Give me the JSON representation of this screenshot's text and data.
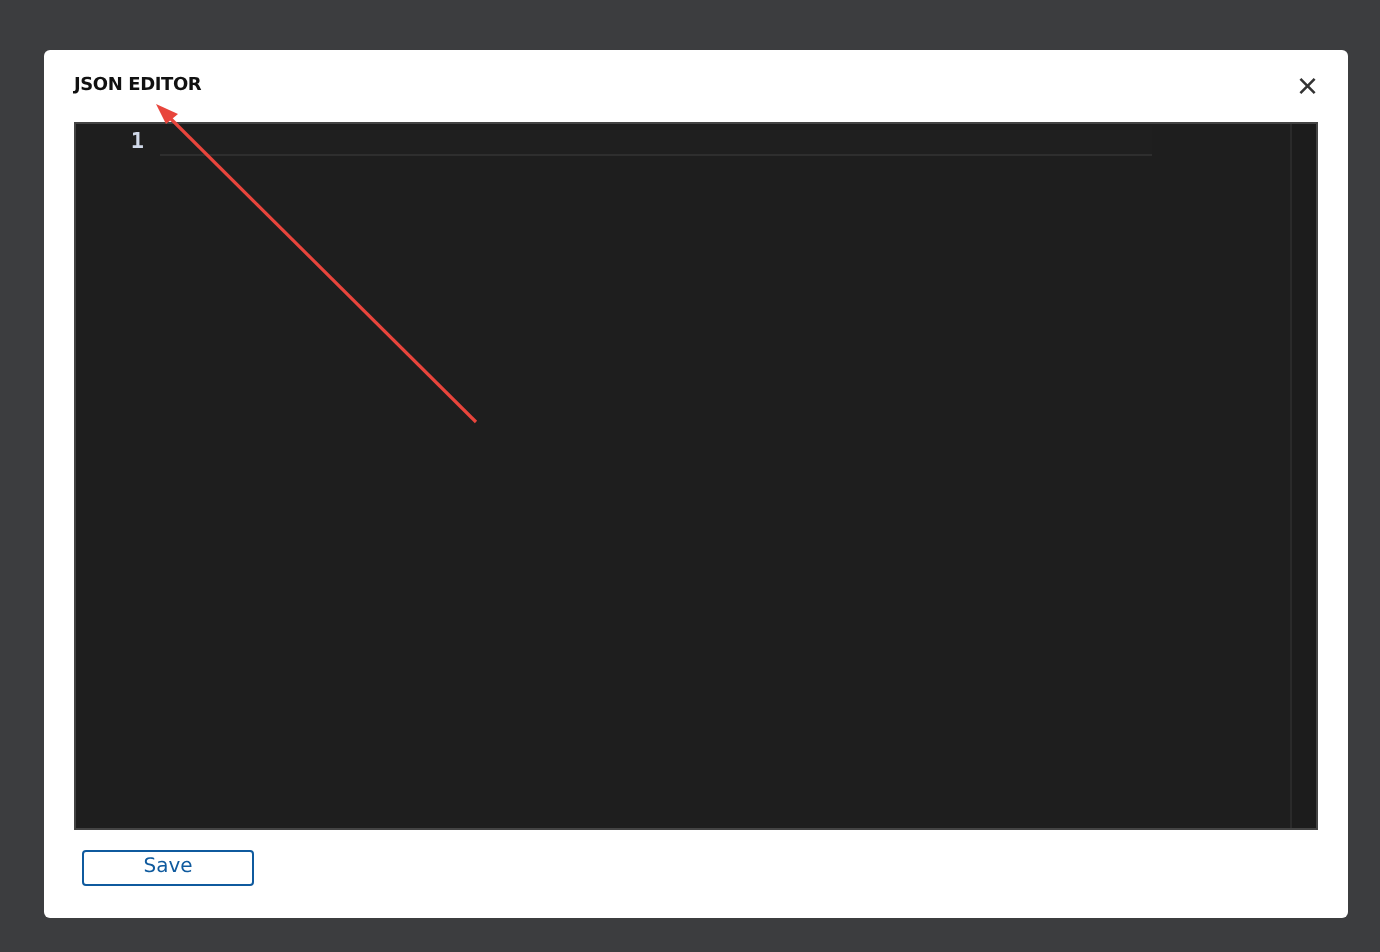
{
  "dialog": {
    "title": "JSON EDITOR",
    "close": "×"
  },
  "editor": {
    "lines": [
      {
        "number": "1",
        "active": true
      }
    ]
  },
  "buttons": [
    {
      "label": "Save"
    }
  ]
}
